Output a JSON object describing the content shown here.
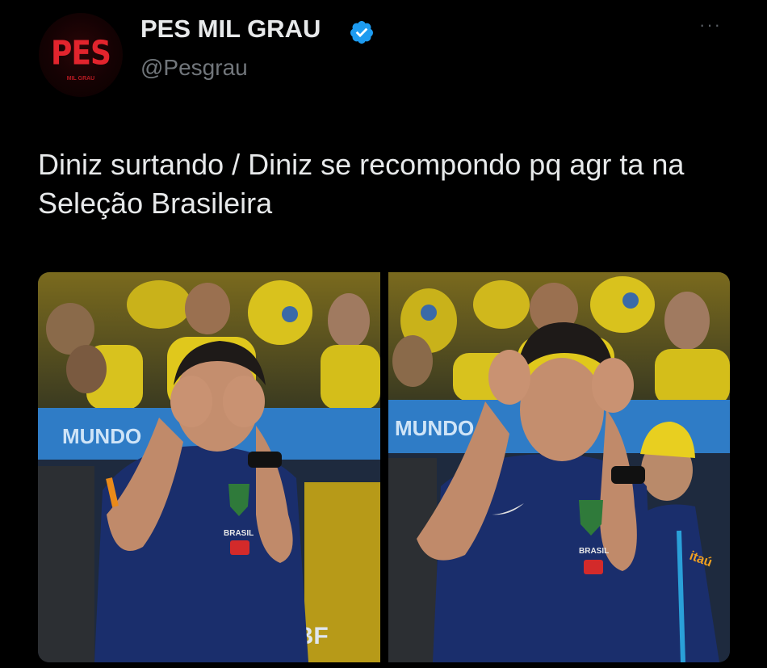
{
  "header": {
    "avatar_logo": "PES",
    "avatar_sublogo": "MIL GRAU",
    "display_name": "PES MIL GRAU",
    "handle": "@Pesgrau",
    "verified_icon": "verified-badge-icon",
    "more_icon": "more-options-icon",
    "more_glyph": "···"
  },
  "tweet": {
    "text": "Diniz surtando / Diniz se recompondo pq agr ta na Seleção Brasileira"
  },
  "media": {
    "left_banner": "MUNDO",
    "right_banner": "MUNDO",
    "left_shirt": "BRASIL",
    "right_shirt": "BRASIL",
    "left_board": "CBF",
    "right_sponsor": "itaú"
  },
  "colors": {
    "background": "#000000",
    "text": "#e7e9ea",
    "secondary": "#71767b",
    "verified": "#1d9bf0",
    "brand_red": "#e2242d"
  }
}
